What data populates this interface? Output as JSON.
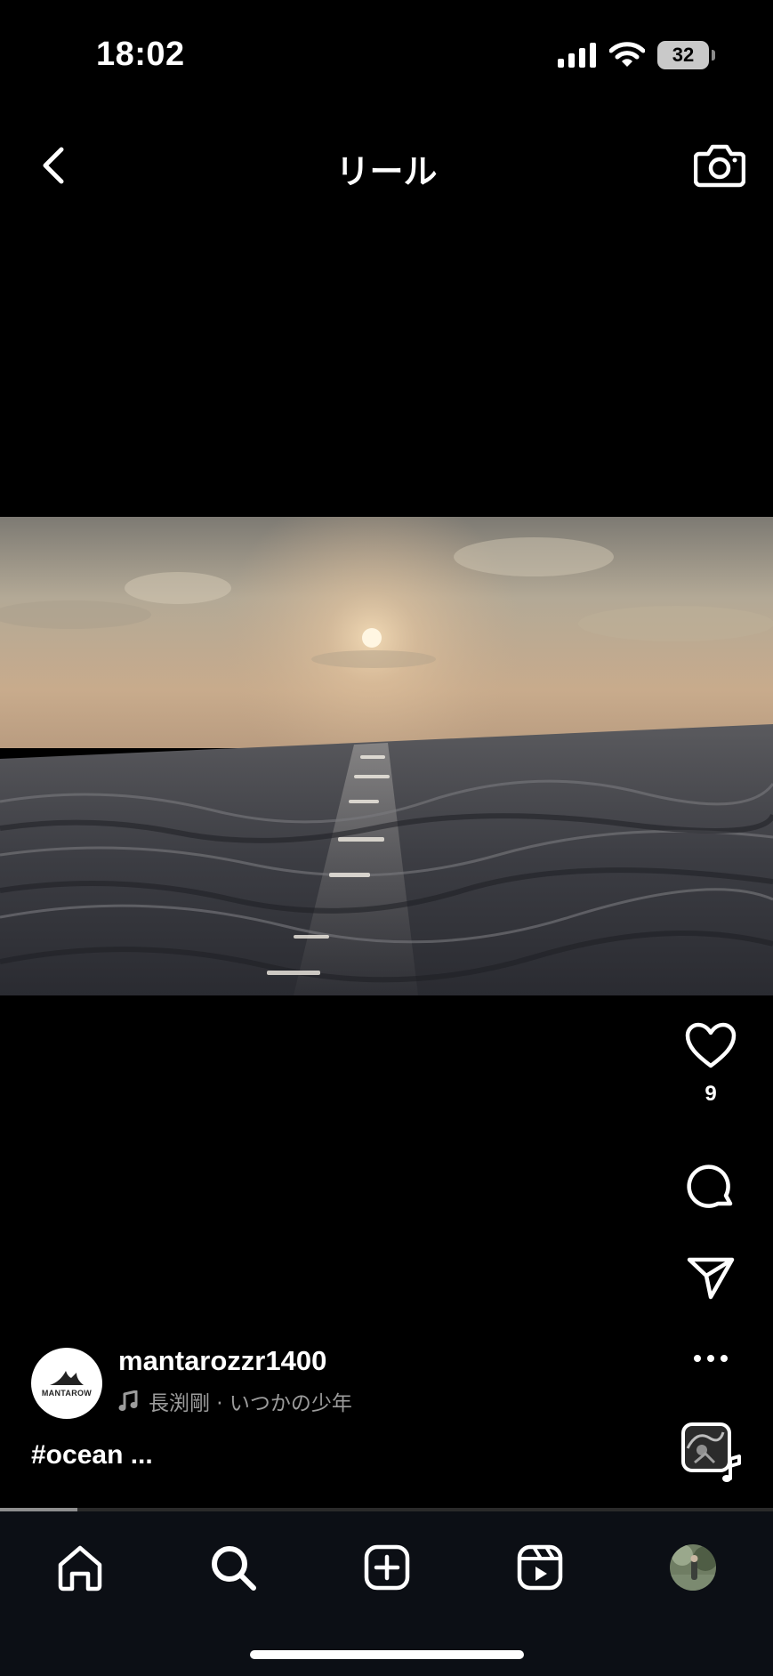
{
  "status_bar": {
    "time": "18:02",
    "battery": "32"
  },
  "header": {
    "title": "リール",
    "back_icon": "chevron-left-icon",
    "camera_icon": "camera-icon"
  },
  "actions": {
    "like_icon": "heart-icon",
    "like_count": "9",
    "comment_icon": "comment-icon",
    "share_icon": "send-icon",
    "more_icon": "ellipsis-icon",
    "audio_icon": "audio-thumbnail-icon"
  },
  "post": {
    "avatar_text": "MANTAROW",
    "username": "mantarozzr1400",
    "music": "長渕剛 · いつかの少年",
    "caption": "#ocean ..."
  },
  "playback": {
    "progress_fraction": 0.1
  },
  "tab_bar": {
    "tabs": [
      "home-icon",
      "search-icon",
      "create-icon",
      "reels-icon",
      "profile-avatar"
    ]
  },
  "colors": {
    "background": "#000000",
    "tab_bar": "#0c0f15",
    "muted_text": "#9c9c9c"
  }
}
